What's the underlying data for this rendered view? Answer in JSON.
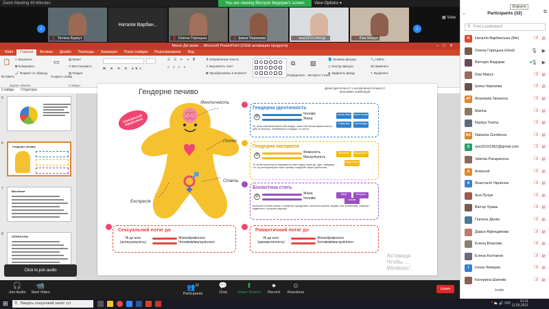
{
  "zoom": {
    "window_title": "Zoom Meeting 40-Minutes",
    "viewing_banner": "You are viewing Вікторія Федорик's screen",
    "view_options": "View Options ▾",
    "view_button": "View",
    "click_to_join_audio": "Click to join audio",
    "controls": {
      "join_audio": "Join Audio",
      "start_video": "Start Video",
      "participants": "Participants",
      "participants_count": "32",
      "chat": "Chat",
      "share_screen": "Share Screen",
      "record": "Record",
      "reactions": "Reactions",
      "leave": "Leave"
    }
  },
  "video_tiles": [
    {
      "name": "Тетяна Буркут",
      "face_color": "#9a6a55",
      "bg_color": "#5c6a6f"
    },
    {
      "name": "Наталія Варбан...",
      "name_only": true
    },
    {
      "name": "Олена Горецька",
      "face_color": "#a0705a",
      "bg_color": "#6a6860"
    },
    {
      "name": "Ірина Черезова",
      "face_color": "#8a5a45",
      "bg_color": "#7c8184"
    },
    {
      "name": "sea15101962@...",
      "face_color": "#d7b5a0",
      "bg_color": "#d9dde0"
    },
    {
      "name": "Єва Макух",
      "face_color": "#8e5e4e",
      "bg_color": "#c7b9a8"
    }
  ],
  "ppt": {
    "title": "Меню Дія мови ... Microsoft PowerPoint (Сбой активации продукта)",
    "tabs": [
      "Файл",
      "Главная",
      "Вставка",
      "Дизайн",
      "Переходы",
      "Анимация",
      "Показ слайдов",
      "Рецензирование",
      "Вид"
    ],
    "ribbon": {
      "paste": "Вставить",
      "cut": "Вырезать",
      "copy": "Копировать",
      "format_painter": "Формат по образцу",
      "clipboard_group": "Буфер обмена",
      "new_slide": "Создать слайд",
      "layout": "Макет",
      "reset": "Восстановить",
      "section": "Раздел",
      "slides_group": "Слайды",
      "font_group": "Шрифт",
      "paragraph_group": "Абзац",
      "text_direction": "Направление текста",
      "align_text": "Выровнять текст",
      "convert_smartart": "Преобразовать в SmartArt",
      "arrange": "Упорядочить",
      "quick_styles": "Экспресс-стили",
      "shape_fill": "Заливка фигуры",
      "shape_outline": "Контур фигуры",
      "shape_effects": "Эффекты фигур",
      "drawing_group": "Рисование",
      "find": "Найти",
      "replace": "Заменить",
      "select": "Выделить",
      "editing_group": "Редактирование"
    },
    "panel_tabs": {
      "slides": "Слайды",
      "structure": "Структура"
    },
    "thumbnails": [
      {
        "num": "5",
        "title": "",
        "kind": "pie"
      },
      {
        "num": "6",
        "title": "Гендерне печиво",
        "kind": "cookie",
        "selected": true
      },
      {
        "num": "7",
        "title": "Висновки",
        "kind": "text"
      },
      {
        "num": "8",
        "title": "ЛІТЕРАТУРА",
        "kind": "text"
      }
    ]
  },
  "slide": {
    "title": "Гендерне печиво",
    "legend_note": "Деякі ідентичності з нескінченної кількості можливих комбінацій",
    "badge": "Сексуальний підкреслено",
    "labels": {
      "identity": "Ідентичність",
      "attraction": "Потяг",
      "sex": "Стать",
      "expression": "Експресія"
    },
    "identity": {
      "title": "Гендерна ідентичність",
      "options": [
        "Чоловік",
        "Жінка"
      ],
      "text": "Те, як ви самі визначаєте свій гендер, свою собі налаштувань власну (або не власну). Необмежено стандарт, зі статтю.",
      "tags": [
        "Чоловік Жінка",
        "Жінка Чоловік",
        "Гендер-квір",
        "Трансгендер"
      ],
      "color": "#2f80c9"
    },
    "expression": {
      "title": "Гендерна експресія",
      "options": [
        "Фемінність",
        "Маскулінність"
      ],
      "text": "Те, як ви презентуєте (виражаєте) свій гендер через дії, одяг, поведінку, і то, що інтерпретують через призму гендерних норм суспільства.",
      "tags": [
        "Фемінність",
        "Маскулінність",
        "Андрогінність"
      ],
      "color": "#f2b81c"
    },
    "sex": {
      "title": "Біологічна стать",
      "options": [
        "Жінка",
        "Чоловік"
      ],
      "text": "Біологічні статеві ознаки, з якими ви народилися, генітальні органи, форма тіла, хромосоми, гормони, відмінності, інтерсекс-варіації.",
      "tags": [
        "Жінка",
        "Інтерсекс",
        "Чоловік"
      ],
      "color": "#9b4fc0"
    },
    "sexual_attraction": {
      "title": "Сексуальний потяг до",
      "left": [
        "Ні до кого",
        "(асексуальність)"
      ],
      "right": [
        "Жінок/фемінного",
        "Чоловіків/маскулінного"
      ]
    },
    "romantic_attraction": {
      "title": "Романтичний потяг до",
      "left": [
        "Ні до кого",
        "(аромантичність)"
      ],
      "right": [
        "Жінок/фемінного",
        "Чоловіків/маскулінного"
      ]
    },
    "watermark": [
      "Активаци",
      "Чтобы ...",
      "Windows\"."
    ]
  },
  "participants_panel": {
    "title": "Participants (32)",
    "tooltip": "Згорнути",
    "search_placeholder": "Find a participant",
    "invite": "Invite",
    "list": [
      {
        "name": "Наталія Варбанська (Me)",
        "initials": "Н",
        "color": "#d94a2e",
        "mic": "muted",
        "cam": "off"
      },
      {
        "name": "Олена Горецька (Host)",
        "initials": "О",
        "color": "#7a5a4a",
        "mic": "on",
        "cam": "on",
        "photo": true
      },
      {
        "name": "Вікторія Федорик",
        "initials": "В",
        "color": "#6a4a5a",
        "mic": "on",
        "cam": "on",
        "photo": true,
        "video_on": true
      },
      {
        "name": "Єва Макух",
        "initials": "Є",
        "color": "#9a6a5a",
        "mic": "muted",
        "cam": "off",
        "photo": true
      },
      {
        "name": "Ірина Черезова",
        "initials": "І",
        "color": "#6a5048",
        "mic": "muted",
        "cam": "off",
        "photo": true
      },
      {
        "name": "Anastasia Tarasova",
        "initials": "AT",
        "color": "#e0862c",
        "mic": "muted",
        "cam": "off"
      },
      {
        "name": "Marina",
        "initials": "M",
        "color": "#8a7a60",
        "mic": "muted",
        "cam": "off",
        "photo": true
      },
      {
        "name": "Nastya Yurina",
        "initials": "N",
        "color": "#5a6a78",
        "mic": "muted",
        "cam": "off",
        "photo": true
      },
      {
        "name": "Natasha Gordeeva",
        "initials": "NG",
        "color": "#e0862c",
        "mic": "muted",
        "cam": "off"
      },
      {
        "name": "sea15101962@gmail.com",
        "initials": "S",
        "color": "#28a06a",
        "mic": "muted",
        "cam": "off"
      },
      {
        "name": "Valeriia Parapanova",
        "initials": "V",
        "color": "#8a6a5a",
        "mic": "muted",
        "cam": "off",
        "photo": true
      },
      {
        "name": "Алексей",
        "initials": "А",
        "color": "#e0862c",
        "mic": "muted",
        "cam": "off"
      },
      {
        "name": "Анастасія Українна",
        "initials": "А",
        "color": "#3a7fd0",
        "mic": "muted",
        "cam": "off"
      },
      {
        "name": "Аня Путря",
        "initials": "А",
        "color": "#9a5a50",
        "mic": "muted",
        "cam": "off",
        "photo": true
      },
      {
        "name": "Віктор Чумак",
        "initials": "В",
        "color": "#7a5a50",
        "mic": "muted",
        "cam": "off",
        "photo": true
      },
      {
        "name": "Гергель Денис",
        "initials": "Г",
        "color": "#4a7a9a",
        "mic": "muted",
        "cam": "off",
        "photo": true
      },
      {
        "name": "Дарья Афендикова",
        "initials": "Д",
        "color": "#c07a6a",
        "mic": "muted",
        "cam": "off",
        "photo": true
      },
      {
        "name": "Елена Власова",
        "initials": "Е",
        "color": "#8a8070",
        "mic": "muted",
        "cam": "off",
        "photo": true
      },
      {
        "name": "Елена Колтакни",
        "initials": "Е",
        "color": "#6a6a7a",
        "mic": "muted",
        "cam": "off",
        "photo": true
      },
      {
        "name": "Ілона Чемерис",
        "initials": "І",
        "color": "#3a7fd0",
        "mic": "muted",
        "cam": "off"
      },
      {
        "name": "Катерина Шапова",
        "initials": "К",
        "color": "#8a6050",
        "mic": "muted",
        "cam": "off",
        "photo": true
      }
    ]
  },
  "taskbar": {
    "search_placeholder": "Введіть пошуковий запит тут",
    "time": "10:31",
    "date": "11.05.2021",
    "tray": "^ ⛅ 🔊 УКР"
  },
  "colors": {
    "zoom_green": "#2eab4c",
    "ppt_red": "#d24726",
    "leave_red": "#e02828",
    "muted_red": "#e02828"
  }
}
